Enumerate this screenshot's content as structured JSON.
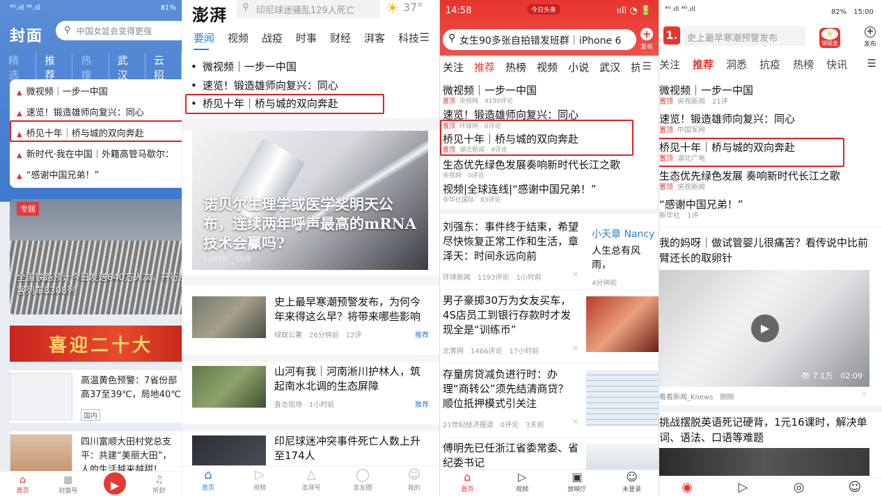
{
  "p1": {
    "status_left": "⁴ᴳ.ıll ⁴ᴳ.ıll",
    "status_right": "81%",
    "logo": "封面",
    "search_placeholder": "中国女篮会变得更强",
    "tabs": [
      "精选",
      "推荐",
      "热搜",
      "武汉",
      "云招"
    ],
    "list": [
      "微视频｜一步一中国",
      "速览！锻造雄师向复兴：同心",
      "桥见十年｜桥与城的双向奔赴",
      "新时代·我在中国｜外籍高管马歇尔：",
      "“感谢中国兄弟！”"
    ],
    "card_tag": "专题",
    "card_caption": "全国铁路预计今日发送640万人次，开行旅客列车8308列",
    "banner": "喜迎二十大",
    "news": [
      {
        "title_a": "高温黄色预警：7省份部",
        "title_b": "高37至39℃，局地40℃",
        "badge": "国内"
      },
      {
        "title_a": "四川富顺大田村党总支",
        "title_b": "平：共建“美丽大田”，",
        "title_c": "人的生活越来越甜！"
      }
    ],
    "nav": [
      "首页",
      "封面号",
      "",
      "听封"
    ]
  },
  "p2": {
    "logo": "澎湃",
    "search_placeholder": "印尼球迷骚乱129人死亡",
    "temperature": "37°",
    "tabs": [
      "要闻",
      "视频",
      "战疫",
      "时事",
      "财经",
      "湃客",
      "科技"
    ],
    "list": [
      "微视频｜一步一中国",
      "速览！锻造雄师向复兴：同心",
      "桥见十年｜桥与城的双向奔赴"
    ],
    "hero": {
      "title": "诺贝尔生理学或医学奖明天公布，连续两年呼声最高的mRNA技术会赢吗?",
      "time": "1小时前",
      "comments": "15评"
    },
    "rows": [
      {
        "title": "史上最早寒潮预警发布，为何今年来得这么早？将带来哪些影响",
        "meta": "绿政公署　26分钟前　12评",
        "rec": "推荐"
      },
      {
        "title": "山河有我｜河南淅川护林人，筑起南水北调的生态屏障",
        "meta": "直击现场　1小时前",
        "rec": "推荐"
      },
      {
        "title": "印尼球迷冲突事件死亡人数上升至174人",
        "meta": "",
        "rec": ""
      }
    ],
    "nav": [
      "首页",
      "视频",
      "澎湃号",
      "澎友圈",
      "我的"
    ]
  },
  "p3": {
    "time": "14:58",
    "pill": "今日头条",
    "status_right": "ııll ◔ 🔋",
    "search_text": "女生90多张自拍错发班群｜iPhone 6",
    "publish": "发布",
    "tabs": [
      "关注",
      "推荐",
      "热榜",
      "视频",
      "小说",
      "武汉",
      "抗"
    ],
    "items": [
      {
        "title": "微视频｜一步一中国",
        "meta": "央视网　4199评论",
        "pin": "置顶"
      },
      {
        "title": "速览！锻造雄师向复兴：同心",
        "meta": "",
        "pin": ""
      },
      {
        "title": "",
        "meta": "环球网　0评论",
        "pin": "置顶"
      },
      {
        "title": "桥见十年｜桥与城的双向奔赴",
        "meta": "湖北新闻　4评论",
        "pin": "置顶"
      },
      {
        "title": "生态优先绿色发展奏响新时代长江之歌",
        "meta": "",
        "pin": ""
      },
      {
        "title": "",
        "meta": "央视网　0评论",
        "pin": ""
      },
      {
        "title": "视频|全球连线|“感谢中国兄弟！”",
        "meta": "",
        "pin": ""
      },
      {
        "title": "",
        "meta": "中华社国际　83评论",
        "pin": ""
      }
    ],
    "news": [
      {
        "title": "刘强东：事件终于结束，希望尽快恢复正常工作和生活，章泽天：时间永远向前",
        "meta": "环球新闻　1193评论　1小时前"
      },
      {
        "title": "男子豪掷30万为女友买车，4S店员工到银行存款时才发现全是“训练币”",
        "meta": "北青网　1466评论　17小时前"
      },
      {
        "title": "存量房贷减负进行时：办理“商转公”须先结清商贷？顺位抵押模式引关注",
        "meta": "21世纪经济报道　0评论　3天前"
      },
      {
        "title": "傅明先已任浙江省委常委、省纪委书记",
        "meta": ""
      }
    ],
    "side_author": "小天章 Nancy",
    "side_text": "人生总有风雨，",
    "side_time": "4分钟前",
    "nav": [
      "首页",
      "视频",
      "放映厅",
      "未登录"
    ]
  },
  "p4": {
    "status_left": "⁴ᴳ.ıll ⁴ᴳ.ıll",
    "status_right": "82%　15:00",
    "logo": "1.",
    "search_placeholder": "史上最早寒潮预警发布",
    "gold": "领现金",
    "publish": "发布",
    "tabs": [
      "关注",
      "推荐",
      "洞悉",
      "抗疫",
      "热榜",
      "快讯"
    ],
    "items": [
      {
        "title": "微视频｜一步一中国",
        "pin": "置顶",
        "meta": "央视新闻　21评"
      },
      {
        "title": "速览！锻造雄师向复兴：同心",
        "pin": "置顶",
        "meta": "中国军网"
      },
      {
        "title": "桥见十年｜桥与城的双向奔赴",
        "pin": "置顶",
        "meta": "湖北广电"
      },
      {
        "title": "生态优先绿色发展 奏响新时代长江之歌",
        "pin": "置顶",
        "meta": "央视新闻"
      },
      {
        "title": "“感谢中国兄弟！”",
        "pin": "",
        "meta": "新华社　1评"
      }
    ],
    "big_title": "我的妈呀｜做试管婴儿很痛苦？看传说中比前臂还长的取卵针",
    "video_info": "👁 7.1万　02:09",
    "source": "看看新闻_Knews　刚刚",
    "title2": "挑战摆脱英语死记硬背，1元16课时，解决单词、语法、口语等难题"
  }
}
